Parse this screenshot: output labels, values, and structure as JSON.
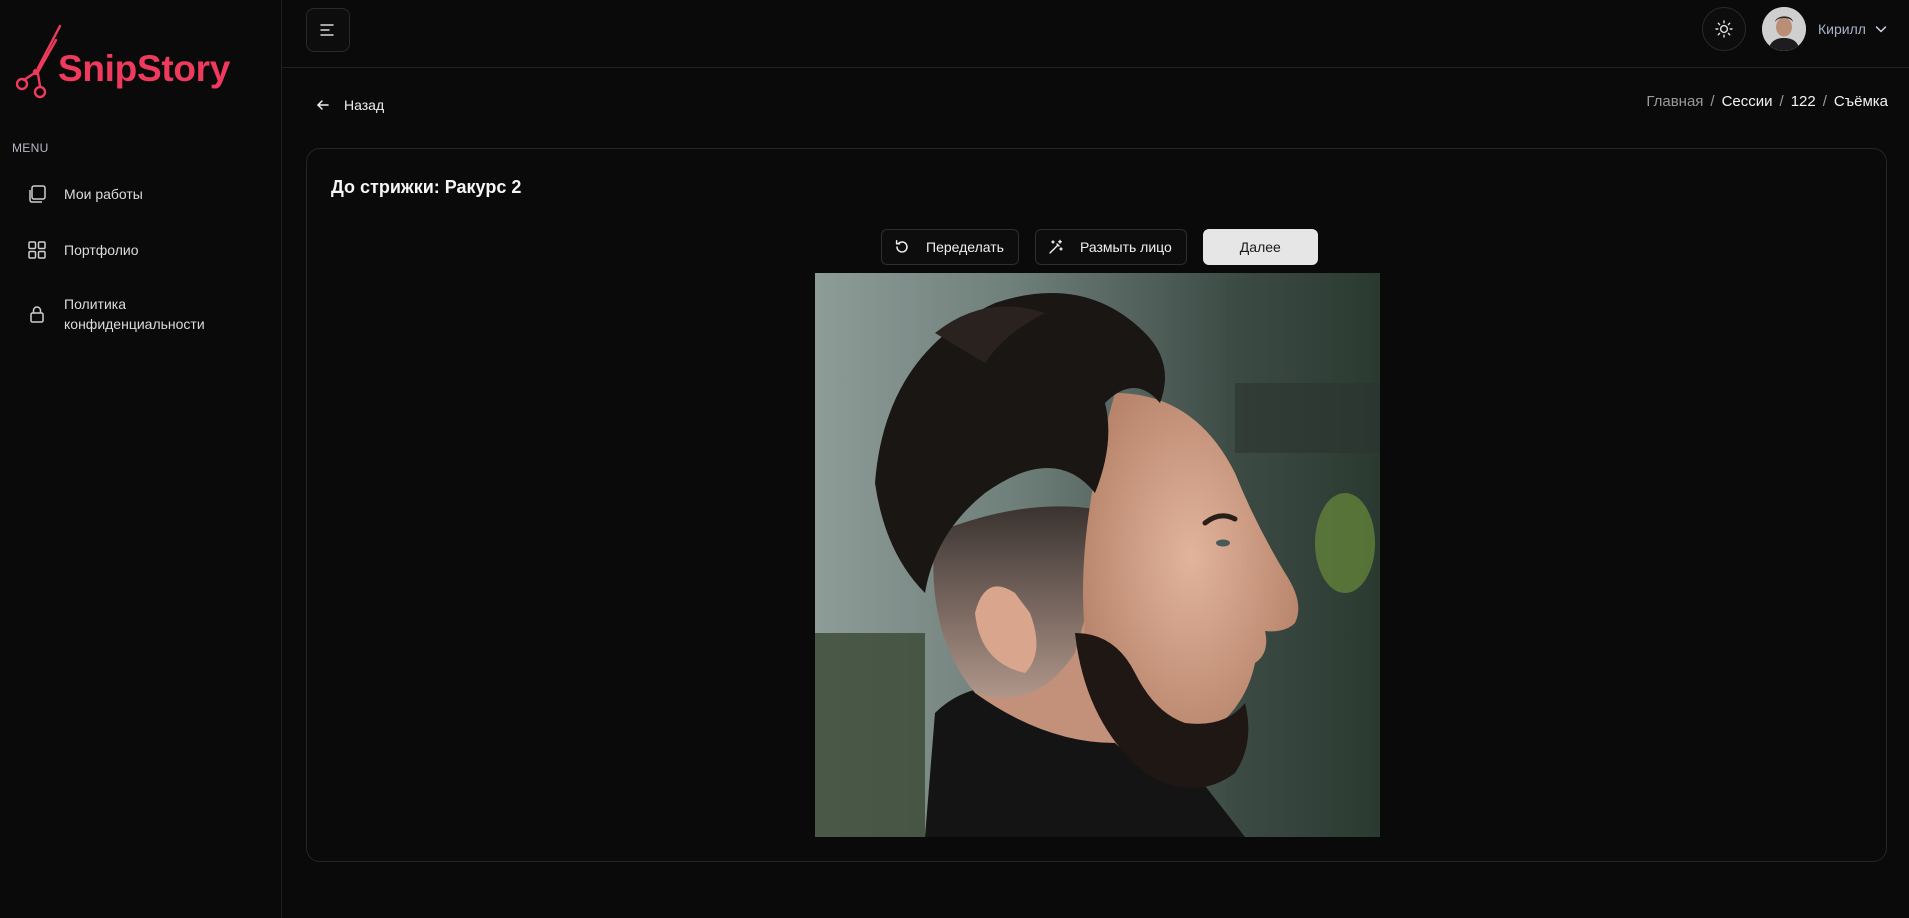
{
  "brand": {
    "name": "SnipStory",
    "color": "#ef3a5d"
  },
  "sidebar": {
    "menu_label": "MENU",
    "items": [
      {
        "label": "Мои работы",
        "icon": "stacked-pages-icon"
      },
      {
        "label": "Портфолио",
        "icon": "grid-icon"
      },
      {
        "label": "Политика конфиденциальности",
        "icon": "lock-icon"
      }
    ]
  },
  "header": {
    "menu_icon": "hamburger-icon",
    "theme_icon": "sun-icon",
    "user_name": "Кирилл"
  },
  "back_label": "Назад",
  "breadcrumb": [
    "Главная",
    "Сессии",
    "122",
    "Съёмка"
  ],
  "card": {
    "title": "До стрижки: Ракурс 2",
    "buttons": {
      "redo": "Переделать",
      "blur": "Размыть лицо",
      "next": "Далее"
    }
  }
}
